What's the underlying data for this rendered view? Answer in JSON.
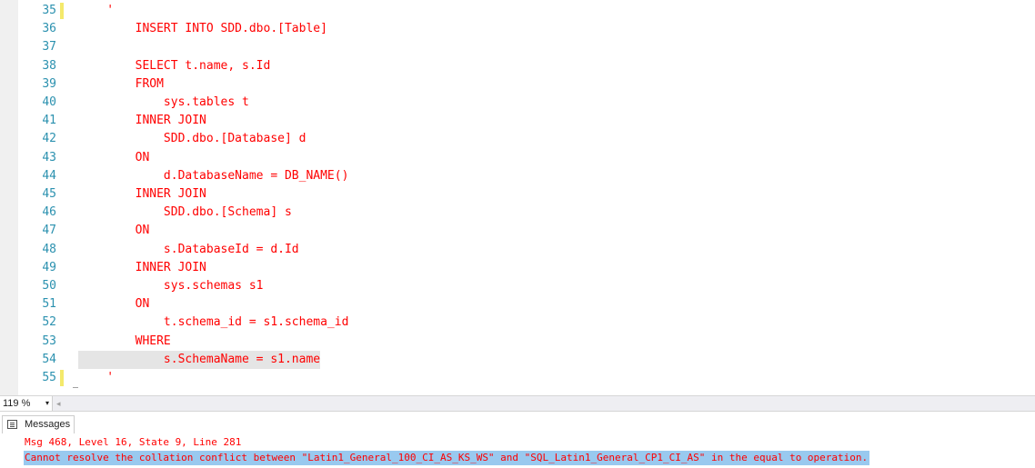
{
  "editor": {
    "lines": [
      {
        "no": "35",
        "text": "    '",
        "marked": true
      },
      {
        "no": "36",
        "text": "        INSERT INTO SDD.dbo.[Table]"
      },
      {
        "no": "37",
        "text": ""
      },
      {
        "no": "38",
        "text": "        SELECT t.name, s.Id"
      },
      {
        "no": "39",
        "text": "        FROM"
      },
      {
        "no": "40",
        "text": "            sys.tables t"
      },
      {
        "no": "41",
        "text": "        INNER JOIN"
      },
      {
        "no": "42",
        "text": "            SDD.dbo.[Database] d"
      },
      {
        "no": "43",
        "text": "        ON"
      },
      {
        "no": "44",
        "text": "            d.DatabaseName = DB_NAME()"
      },
      {
        "no": "45",
        "text": "        INNER JOIN"
      },
      {
        "no": "46",
        "text": "            SDD.dbo.[Schema] s"
      },
      {
        "no": "47",
        "text": "        ON"
      },
      {
        "no": "48",
        "text": "            s.DatabaseId = d.Id"
      },
      {
        "no": "49",
        "text": "        INNER JOIN"
      },
      {
        "no": "50",
        "text": "            sys.schemas s1"
      },
      {
        "no": "51",
        "text": "        ON"
      },
      {
        "no": "52",
        "text": "            t.schema_id = s1.schema_id"
      },
      {
        "no": "53",
        "text": "        WHERE"
      },
      {
        "no": "54",
        "text": "            s.SchemaName = s1.name",
        "highlight": true
      },
      {
        "no": "55",
        "text": "    '",
        "marked": true
      }
    ]
  },
  "statusbar": {
    "zoom": "119 %",
    "zoom_arrow": "▾",
    "scroll_left": "◂"
  },
  "messages": {
    "tab_label": "Messages",
    "lines": [
      "Msg 468, Level 16, State 9, Line 281",
      "Cannot resolve the collation conflict between \"Latin1_General_100_CI_AS_KS_WS\" and \"SQL_Latin1_General_CP1_CI_AS\" in the equal to operation."
    ]
  },
  "colors": {
    "line_number": "#2b91af",
    "code_text": "#ff0000",
    "change_marker": "#f4e96b",
    "selection": "#99c9ef"
  }
}
